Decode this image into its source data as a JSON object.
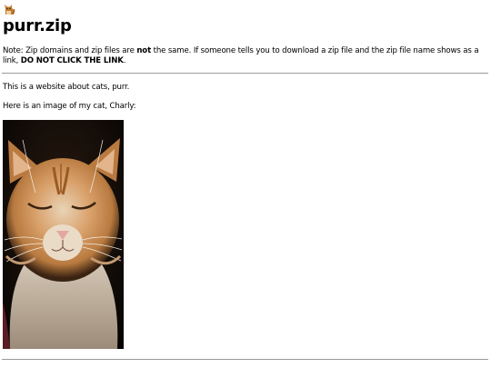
{
  "site": {
    "logo_icon": "cat-icon",
    "title": "purr.zip"
  },
  "note": {
    "prefix": "Note: Zip domains and zip files are ",
    "emphasis": "not",
    "middle": " the same. If someone tells you to download a zip file and the zip file name shows as a link, ",
    "warning": "DO NOT CLICK THE LINK",
    "suffix": "."
  },
  "content": {
    "intro": "This is a website about cats, purr.",
    "image_caption": "Here is an image of my cat, Charly:",
    "photo_subject": "cat-photo"
  }
}
